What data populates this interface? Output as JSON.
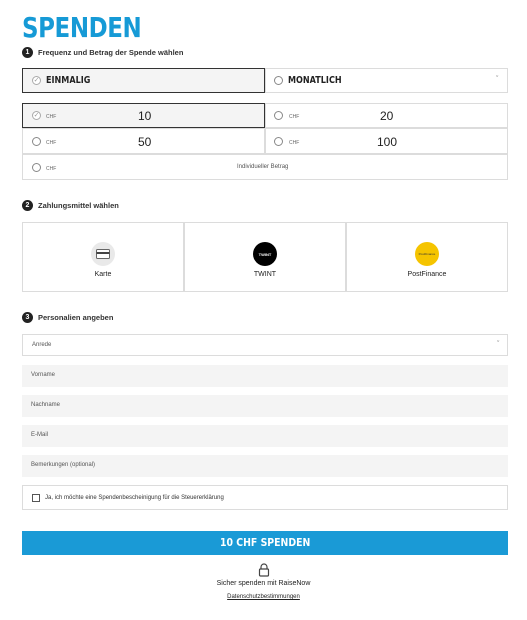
{
  "title": "SPENDEN",
  "step1": {
    "num": "1",
    "label": "Frequenz und Betrag der Spende wählen"
  },
  "frequency": {
    "once": "EINMALIG",
    "monthly": "MONATLICH",
    "selected": "once"
  },
  "amounts": {
    "currency": "CHF",
    "options": [
      "10",
      "20",
      "50",
      "100"
    ],
    "selected": "10",
    "custom_placeholder": "Individueller Betrag"
  },
  "step2": {
    "num": "2",
    "label": "Zahlungsmittel wählen"
  },
  "payment": {
    "card": "Karte",
    "twint": "TWINT",
    "twint_icon_text": "TWINT",
    "postfinance": "PostFinance",
    "postfinance_icon_text": "PostFinance"
  },
  "step3": {
    "num": "3",
    "label": "Personalien angeben"
  },
  "personal": {
    "salutation": "Anrede",
    "first_name": "Vorname",
    "last_name": "Nachname",
    "email": "E-Mail",
    "comments": "Bemerkungen (optional)",
    "tax_receipt": "Ja, ich möchte eine Spendenbescheinigung für die Steuererklärung"
  },
  "cta_label": "10 CHF SPENDEN",
  "secure_text": "Sicher spenden mit RaiseNow",
  "privacy_link": "Datenschutzbestimmungen",
  "colors": {
    "accent": "#169ad6",
    "cta": "#1a9ad6",
    "postfinance": "#f5c400",
    "twint": "#000000"
  },
  "icons": {
    "selected_marker": "check-icon",
    "dropdown": "chevron-down-icon",
    "lock": "lock-icon"
  }
}
